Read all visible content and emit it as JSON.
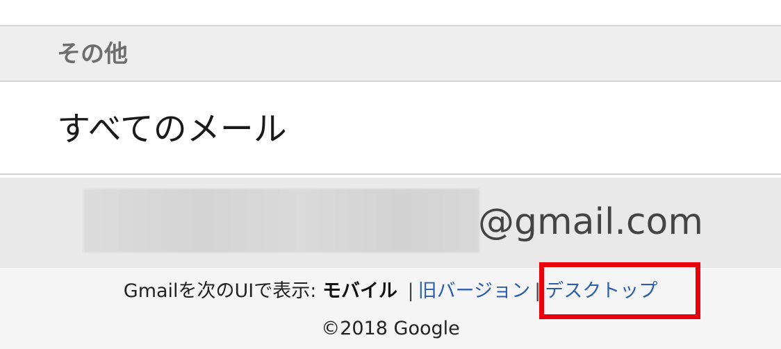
{
  "section": {
    "title": "その他"
  },
  "list": {
    "all_mail_label": "すべてのメール"
  },
  "account": {
    "email_domain": "@gmail.com"
  },
  "footer": {
    "ui_prefix": "Gmailを次のUIで表示:",
    "ui_current": "モバイル",
    "separator": "|",
    "ui_old_version": "旧バージョン",
    "ui_desktop": "デスクトップ",
    "copyright": "©2018 Google"
  },
  "colors": {
    "link": "#2a5db0",
    "highlight": "#e8000b"
  }
}
